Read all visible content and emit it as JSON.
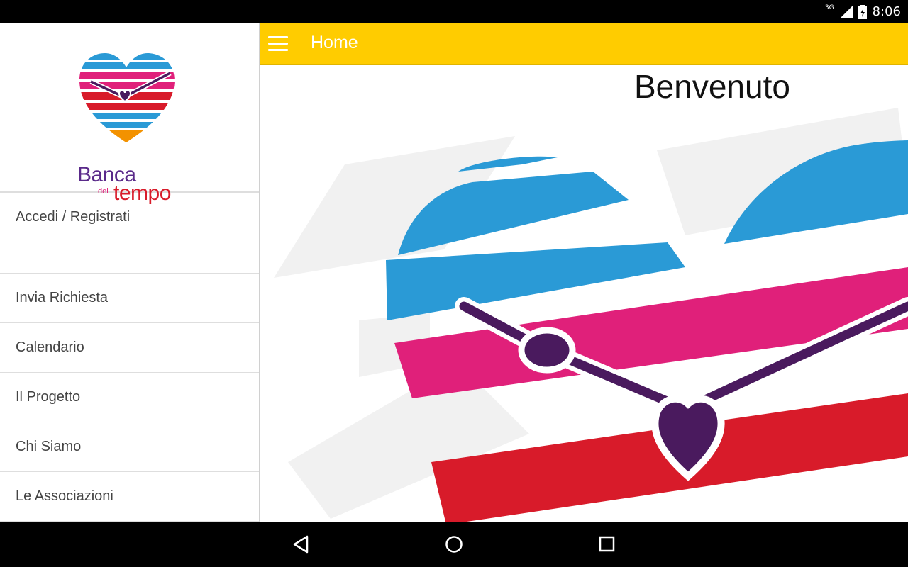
{
  "status_bar": {
    "network": "3G",
    "time": "8:06"
  },
  "brand": {
    "line1": "Banca",
    "line2": "del",
    "line3": "tempo"
  },
  "drawer": {
    "items": [
      {
        "label": "Accedi / Registrati"
      },
      {
        "label": ""
      },
      {
        "label": "Invia Richiesta"
      },
      {
        "label": "Calendario"
      },
      {
        "label": "Il Progetto"
      },
      {
        "label": "Chi Siamo"
      },
      {
        "label": "Le Associazioni"
      }
    ]
  },
  "app_bar": {
    "title": "Home",
    "color": "#ffcc00"
  },
  "main": {
    "heading": "Benvenuto"
  },
  "icons": {
    "menu": "hamburger-menu-icon",
    "back": "back-triangle-icon",
    "home": "home-circle-icon",
    "recents": "recents-square-icon"
  }
}
